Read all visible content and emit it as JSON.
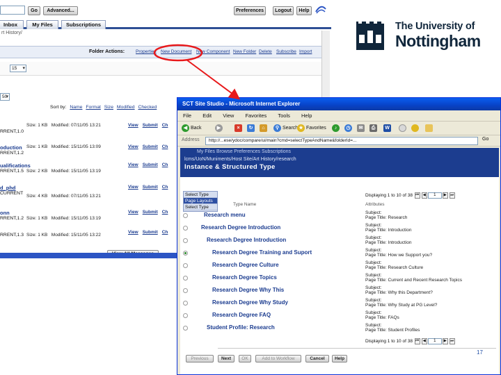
{
  "background_window": {
    "go_label": "Go",
    "advanced_label": "Advanced...",
    "preferences_label": "Preferences",
    "logout_label": "Logout",
    "help_label": "Help",
    "tabs": [
      "Inbox",
      "My Files",
      "Subscriptions"
    ],
    "breadcrumb": "rt History/",
    "folder_actions_label": "Folder Actions:",
    "folder_actions": [
      "Properties",
      "New Document",
      "New Component",
      "New Folder",
      "Delete",
      "Subscribe",
      "Import"
    ],
    "page_size": "15",
    "items_per_page": "50",
    "sort_by_label": "Sort by:",
    "sort_links": [
      "Name",
      "Format",
      "Size",
      "Modified",
      "Checked"
    ],
    "rows": [
      {
        "title": "",
        "status": "RRENT,1.0",
        "size": "Size: 1 KB",
        "modified": "Modified: 07/11/05 13:21",
        "links": [
          "View",
          "Submit",
          "Ch"
        ]
      },
      {
        "title": "oduction",
        "status": "RRENT,1.2",
        "size": "Size: 1 KB",
        "modified": "Modified: 15/11/05 13:09",
        "links": [
          "View",
          "Submit",
          "Ch"
        ]
      },
      {
        "title": "ualifications",
        "status": "RRENT,1.5",
        "size": "Size: 2 KB",
        "modified": "Modified: 15/11/05 13:19",
        "links": [
          "View",
          "Submit",
          "Ch"
        ]
      },
      {
        "title": "d_phd",
        "status": "CURRENT",
        "size": "Size: 4 KB",
        "modified": "Modified: 07/11/05 13:21",
        "links": [
          "View",
          "Submit",
          "Ch"
        ]
      },
      {
        "title": "onn",
        "status": "RRENT,1.2",
        "size": "Size: 1 KB",
        "modified": "Modified: 15/11/05 13:19",
        "links": [
          "View",
          "Submit",
          "Ch"
        ]
      },
      {
        "title": "",
        "status": "RRENT,1.3",
        "size": "Size: 1 KB",
        "modified": "Modified: 15/11/05 13:22",
        "links": [
          "View",
          "Submit",
          "Ch"
        ]
      }
    ],
    "view_all_messages": "View All Messages"
  },
  "logo": {
    "line1": "The University of",
    "line2": "Nottingham",
    "color": "#10263b"
  },
  "annotation": {
    "color": "#e8191b"
  },
  "popup": {
    "window_title": "SCT Site Studio - Microsoft Internet Explorer",
    "menu": [
      "File",
      "Edit",
      "View",
      "Favorites",
      "Tools",
      "Help"
    ],
    "toolbar": {
      "back": "Back",
      "search": "Search",
      "favorites": "Favorites"
    },
    "address_label": "Address",
    "address_value": "http://...ese/ydoc/compare/ui/main?cmd=selectTypeAndName&folderId=...",
    "go_label": "Go",
    "ghost_tabs": "My Files  Browse  Preferences  Subscriptions",
    "path": "lcms/UoN/Muniments/Host Site/Art History/research",
    "page_title": "Instance & Structured Type",
    "left_select": [
      "Select Type",
      "Page Layouts",
      "Select Type"
    ],
    "type_name_header": "Type Name",
    "attributes_header": "Attributes",
    "pager": "Displaying 1 to 10 of 38",
    "page_field": "1",
    "items": [
      {
        "name": "Research menu",
        "subject": "Subject:",
        "page_title": "Page Title:  Research",
        "selected": false
      },
      {
        "name": "Research Degree Introduction",
        "subject": "Subject:",
        "page_title": "Page Title:  Introduction",
        "selected": false
      },
      {
        "name": "Research Degree Introduction",
        "subject": "Subject:",
        "page_title": "Page Title:  Introduction",
        "selected": false
      },
      {
        "name": "Research Degree Training and Suport",
        "subject": "Subject:",
        "page_title": "Page Title:  How we Support you?",
        "selected": true
      },
      {
        "name": "Research Degree Culture",
        "subject": "Subject:",
        "page_title": "Page Title:  Research Culture",
        "selected": false
      },
      {
        "name": "Research Degree Topics",
        "subject": "Subject:",
        "page_title": "Page Title:  Current and Recent Research Topics",
        "selected": false
      },
      {
        "name": "Research Degree Why This",
        "subject": "Subject:",
        "page_title": "Page Title:  Why this Department?",
        "selected": false
      },
      {
        "name": "Research Degree Why Study",
        "subject": "Subject:",
        "page_title": "Page Title:  Why Study at PG Level?",
        "selected": false
      },
      {
        "name": "Research Degree FAQ",
        "subject": "Subject:",
        "page_title": "Page Title:  FAQs",
        "selected": false
      },
      {
        "name": "Student Profile: Research",
        "subject": "Subject:",
        "page_title": "Page Title:  Student Profiles",
        "selected": false
      }
    ],
    "buttons": [
      "Previous",
      "Next",
      "OK",
      "Add to Workflow",
      "Cancel",
      "Help"
    ]
  },
  "slide_number": "17"
}
